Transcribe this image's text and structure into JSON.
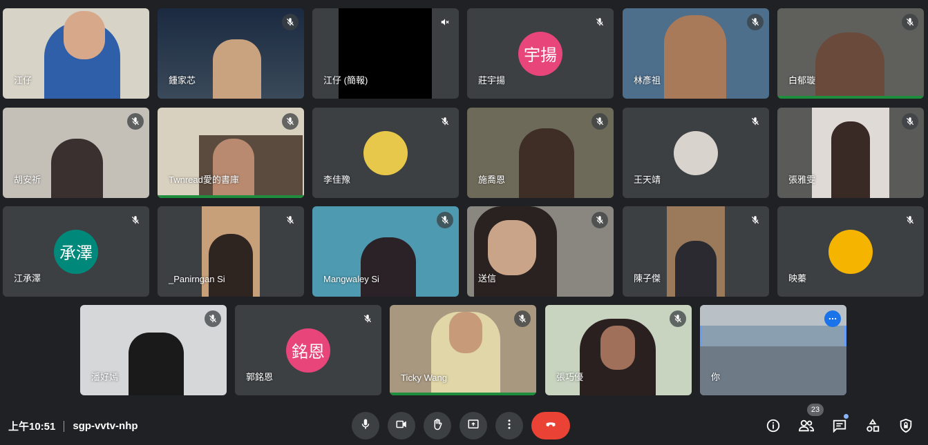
{
  "participants": [
    {
      "name": "江仔",
      "muted": false
    },
    {
      "name": "鍾家芯",
      "muted": true
    },
    {
      "name": "江仔 (簡報)",
      "muted": true
    },
    {
      "name": "莊宇揚",
      "muted": true,
      "initials": "宇揚",
      "avatar_color": "#e8457b"
    },
    {
      "name": "林彥祖",
      "muted": true
    },
    {
      "name": "白郁璇",
      "muted": true
    },
    {
      "name": "胡安祈",
      "muted": true
    },
    {
      "name": "Twnread愛的書庫",
      "muted": true
    },
    {
      "name": "李佳豫",
      "muted": true
    },
    {
      "name": "施喬恩",
      "muted": true
    },
    {
      "name": "王天靖",
      "muted": true
    },
    {
      "name": "張雅雯",
      "muted": true
    },
    {
      "name": "江承澤",
      "muted": true,
      "initials": "承澤",
      "avatar_color": "#00897b"
    },
    {
      "name": "_Panirngan Si",
      "muted": true
    },
    {
      "name": "Mangwaley Si",
      "muted": true
    },
    {
      "name": "送信",
      "muted": true
    },
    {
      "name": "陳子傑",
      "muted": true
    },
    {
      "name": "映蓁",
      "muted": true
    },
    {
      "name": "潘好嫣",
      "muted": true
    },
    {
      "name": "郭銘恩",
      "muted": true,
      "initials": "銘恩",
      "avatar_color": "#e8457b"
    },
    {
      "name": "Ticky Wang",
      "muted": true
    },
    {
      "name": "張巧優",
      "muted": true
    },
    {
      "name": "你",
      "muted": false
    }
  ],
  "footer": {
    "time": "上午10:51",
    "meeting_code": "sgp-vvtv-nhp",
    "participant_count": "23"
  },
  "colors": {
    "background": "#202124",
    "tile": "#3c4043",
    "end_call": "#ea4335",
    "speaking": "#1e8e3e",
    "self_border": "#669df6"
  },
  "icons": [
    "mic-icon",
    "camera-icon",
    "raise-hand-icon",
    "present-icon",
    "more-icon",
    "end-call-icon",
    "info-icon",
    "people-icon",
    "chat-icon",
    "activities-icon",
    "host-controls-icon",
    "mic-off-icon",
    "volume-off-icon"
  ]
}
